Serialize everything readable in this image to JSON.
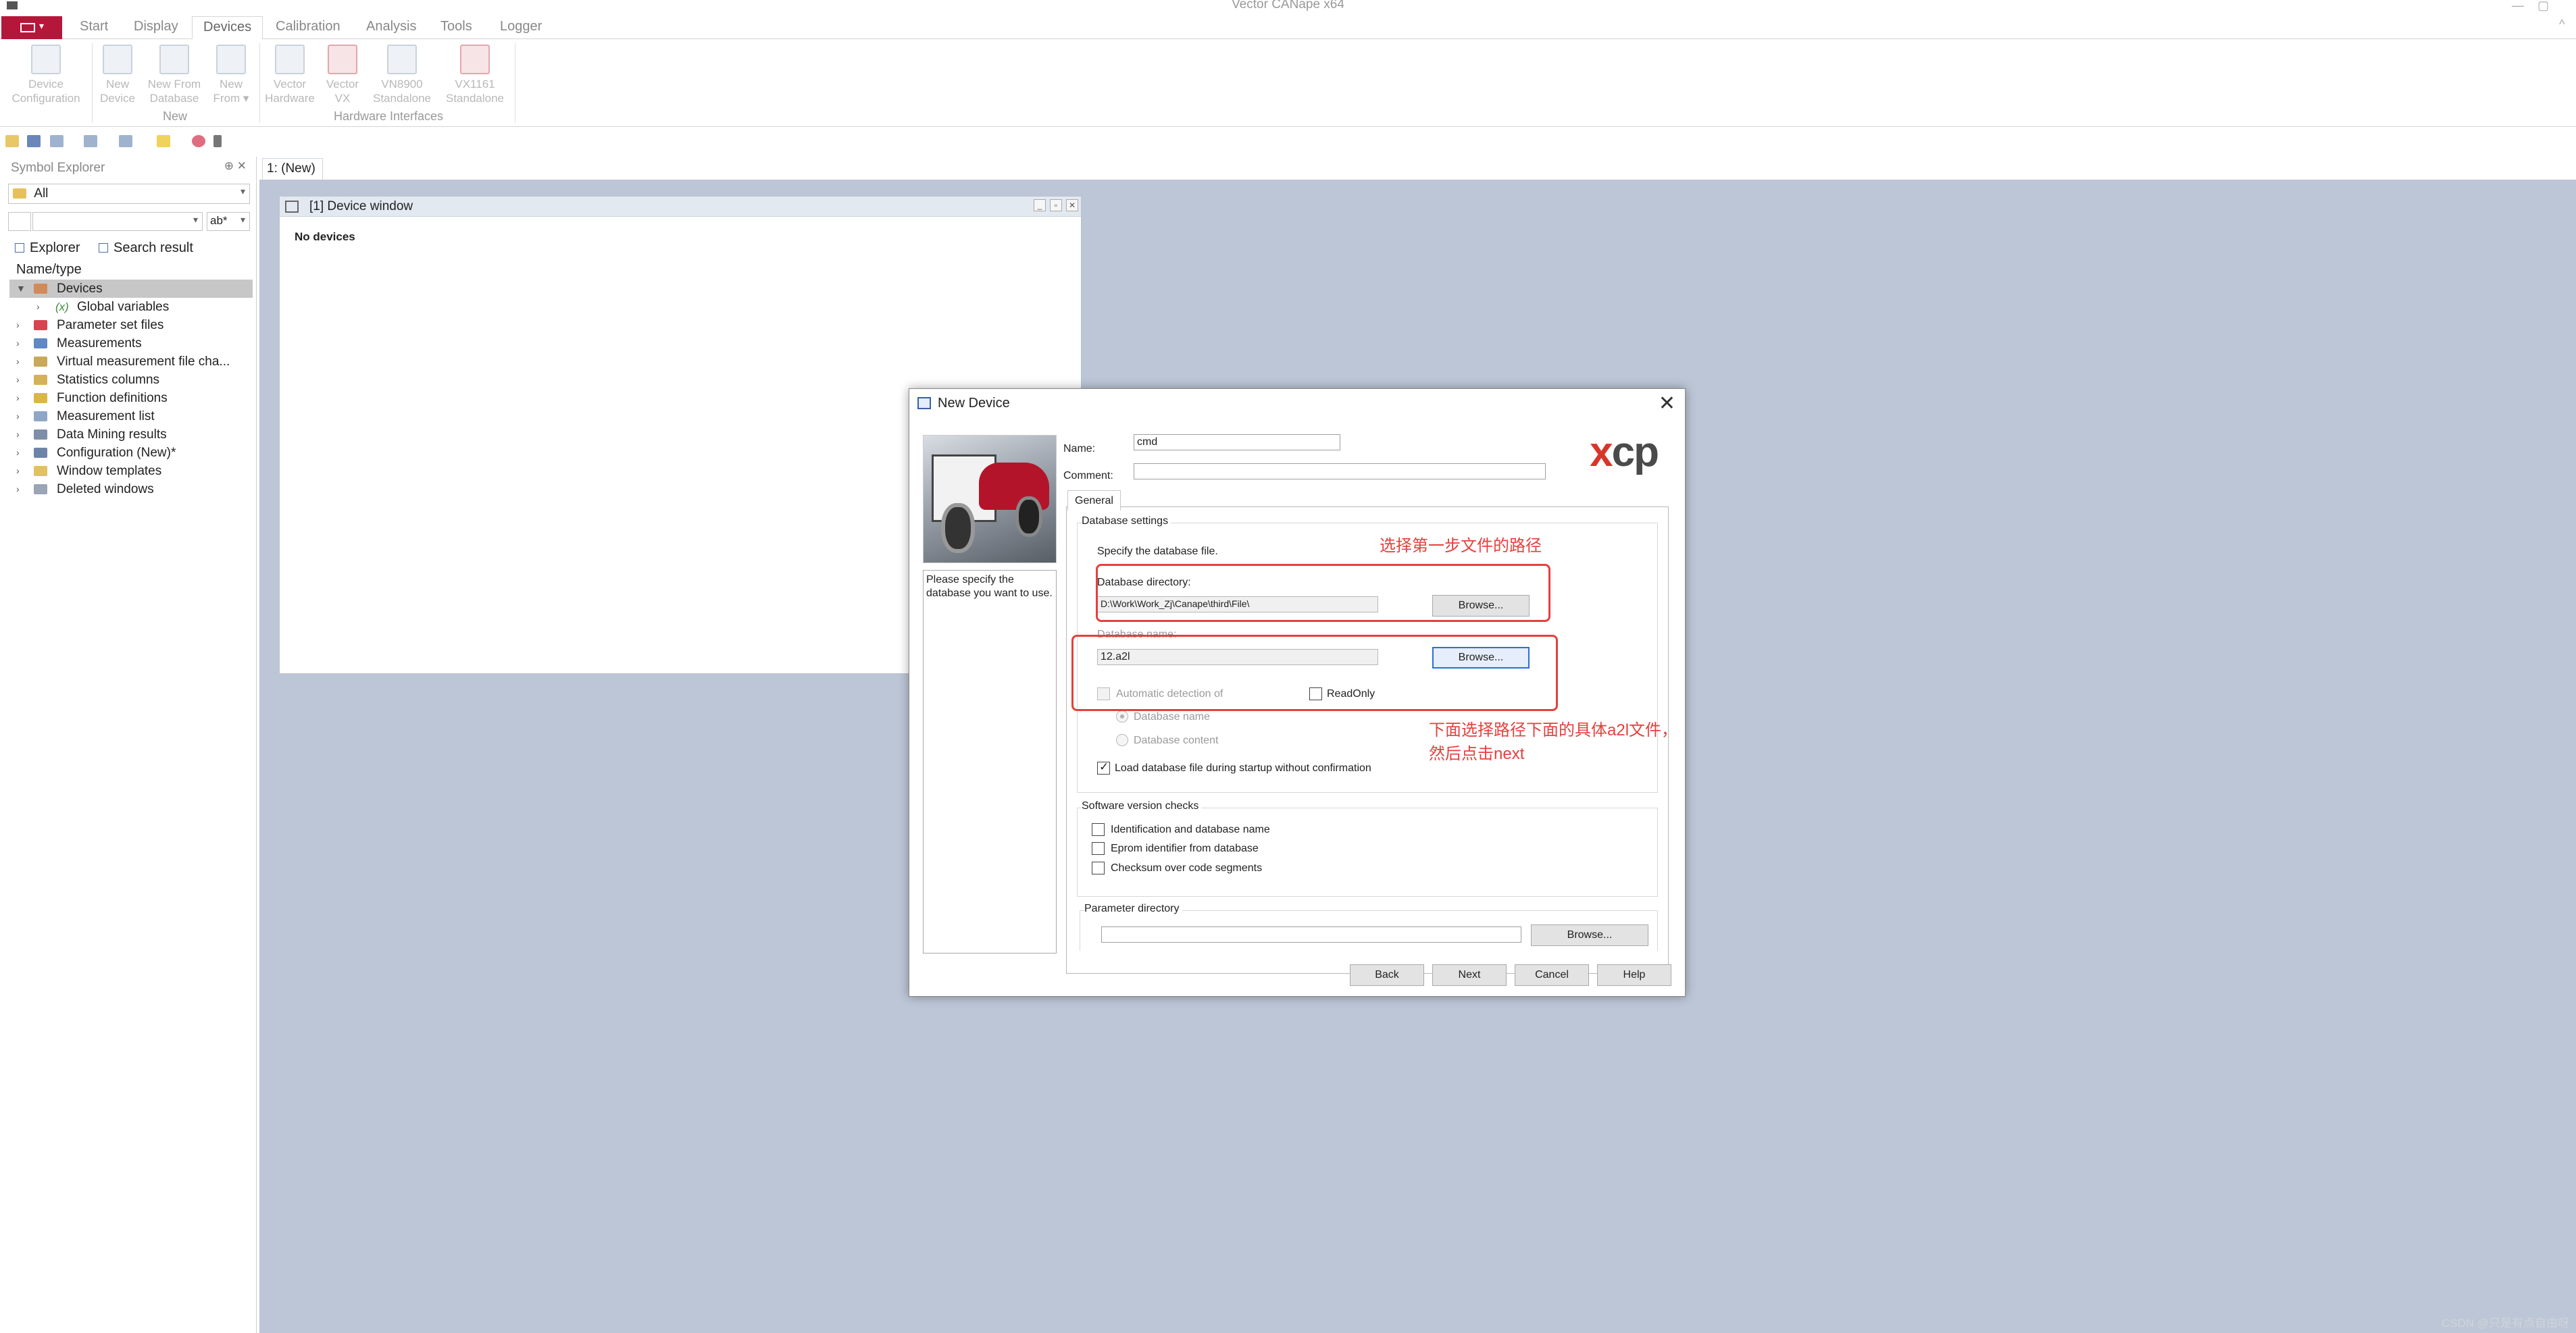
{
  "app": {
    "title": "Vector CANape x64",
    "window_controls": [
      "—",
      "▢",
      "^"
    ]
  },
  "ribbon": {
    "tabs": [
      "Start",
      "Display",
      "Devices",
      "Calibration",
      "Analysis",
      "Tools",
      "Logger"
    ],
    "active_tab": "Devices",
    "buttons": {
      "device_config": [
        "Device",
        "Configuration"
      ],
      "new_device": [
        "New",
        "Device"
      ],
      "new_from_db": [
        "New From",
        "Database"
      ],
      "new_from": [
        "New",
        "From ▾"
      ],
      "vector_hw": [
        "Vector",
        "Hardware"
      ],
      "vector_vx": [
        "Vector",
        "VX"
      ],
      "vn8900": [
        "VN8900",
        "Standalone"
      ],
      "vx1161": [
        "VX1161",
        "Standalone"
      ]
    },
    "groups": {
      "new": "New",
      "hw": "Hardware Interfaces"
    }
  },
  "symbol_explorer": {
    "title": "Symbol Explorer",
    "header_buttons": "⊕ ✕",
    "filter": "All",
    "search_placeholder": "",
    "search_mode": "ab*",
    "subtabs": [
      "Explorer",
      "Search result"
    ],
    "column": "Name/type",
    "tree": [
      "Devices",
      "Global variables",
      "Parameter set files",
      "Measurements",
      "Virtual measurement file cha...",
      "Statistics columns",
      "Function definitions",
      "Measurement list",
      "Data Mining results",
      "Configuration (New)*",
      "Window templates",
      "Deleted windows"
    ],
    "global_var_glyph": "(x)"
  },
  "workspace": {
    "tab": "1: (New)",
    "device_window": {
      "title": "[1] Device window",
      "empty_text": "No devices"
    }
  },
  "dialog": {
    "title": "New Device",
    "info_text": "Please specify the database you want to use.",
    "name_label": "Name:",
    "name_value": "cmd",
    "comment_label": "Comment:",
    "comment_value": "",
    "logo": {
      "x": "x",
      "cp": "cp"
    },
    "tab": "General",
    "db_settings": {
      "title": "Database settings",
      "specify": "Specify the database file.",
      "dir_label": "Database directory:",
      "dir_value": "D:\\Work\\Work_Zj\\Canape\\third\\File\\",
      "browse": "Browse...",
      "name_label": "Database name:",
      "name_value": "12.a2l",
      "auto_detect": "Automatic detection of",
      "readonly": "ReadOnly",
      "radio_name": "Database name",
      "radio_content": "Database content",
      "load_startup": "Load database file during startup without confirmation"
    },
    "sw_checks": {
      "title": "Software version checks",
      "items": [
        "Identification and database name",
        "Eprom identifier from database",
        "Checksum over code segments"
      ]
    },
    "param_dir": {
      "title": "Parameter directory",
      "value": "",
      "browse": "Browse..."
    },
    "buttons": [
      "Back",
      "Next",
      "Cancel",
      "Help"
    ],
    "close_glyph": "✕"
  },
  "annotations": {
    "top": "选择第一步文件的路径",
    "bottom_line1": "下面选择路径下面的具体a2l文件，",
    "bottom_line2": "然后点击next",
    "color": "#e5403d"
  },
  "watermark": "CSDN @只是有点自由呀",
  "colors": {
    "brand_red": "#b5173a",
    "workspace_bg": "#bcc6d6",
    "tree_selection": "#c7c7c7"
  }
}
